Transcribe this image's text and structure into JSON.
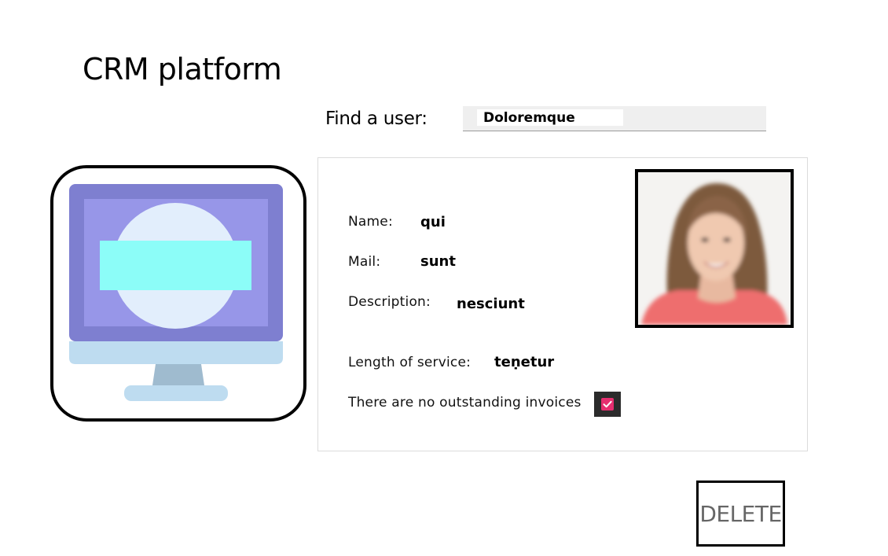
{
  "app": {
    "title": "CRM platform"
  },
  "search": {
    "label": "Find a user:",
    "value": "Doloremque"
  },
  "profile": {
    "name_label": "Name:",
    "name_value": "qui",
    "mail_label": "Mail:",
    "mail_value": "sunt",
    "description_label": "Description:",
    "description_value": "nesciunt",
    "service_label": "Length of service:",
    "service_value": "teṇetur",
    "invoices_label": "There are no outstanding invoices",
    "invoices_checked": true
  },
  "actions": {
    "delete_label": "DELETE"
  },
  "icons": {
    "app_icon": "computer-monitor-icon",
    "checkbox_mark": "check-icon"
  },
  "colors": {
    "checkbox_accent": "#e62e6f",
    "monitor_frame": "#7e7fd0",
    "monitor_screen": "#9796e8",
    "monitor_circle": "#e2eefc",
    "monitor_bar": "#8cfdf8",
    "monitor_base": "#bedcf0",
    "monitor_stand": "#9fbbcf"
  }
}
